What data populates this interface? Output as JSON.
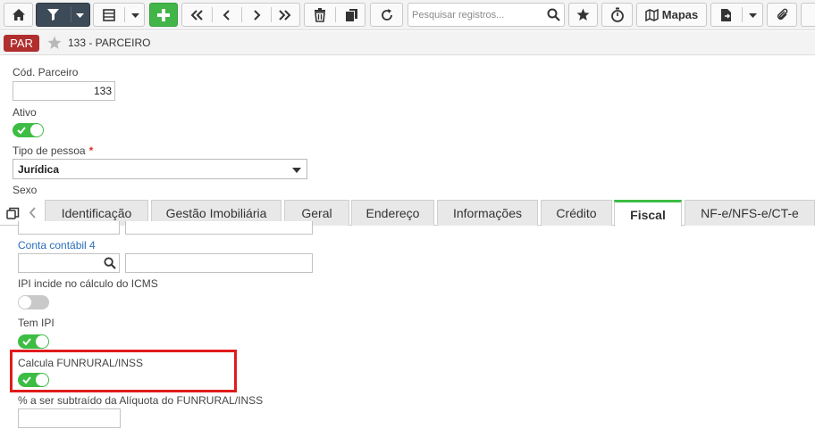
{
  "toolbar": {
    "search_placeholder": "Pesquisar registros...",
    "mapas_label": "Mapas"
  },
  "header": {
    "badge": "PAR",
    "title": "133 - PARCEIRO"
  },
  "form": {
    "cod_parceiro_label": "Cód. Parceiro",
    "cod_parceiro_value": "133",
    "ativo_label": "Ativo",
    "ativo_value": true,
    "tipo_pessoa_label": "Tipo de pessoa",
    "tipo_pessoa_required": "*",
    "tipo_pessoa_value": "Jurídica",
    "sexo_label": "Sexo"
  },
  "tabs": [
    {
      "label": "Identificação"
    },
    {
      "label": "Gestão Imobiliária"
    },
    {
      "label": "Geral"
    },
    {
      "label": "Endereço"
    },
    {
      "label": "Informações"
    },
    {
      "label": "Crédito"
    },
    {
      "label": "Fiscal",
      "active": true
    },
    {
      "label": "NF-e/NFS-e/CT-e"
    }
  ],
  "fiscal": {
    "conta_contabil_label": "Conta contábil 4",
    "ipi_label": "IPI incide no cálculo do ICMS",
    "ipi_value": false,
    "tem_ipi_label": "Tem IPI",
    "tem_ipi_value": true,
    "funrural_label": "Calcula FUNRURAL/INSS",
    "funrural_value": true,
    "percent_label": "% a ser subtraído da Alíquota do FUNRURAL/INSS"
  },
  "colors": {
    "accent_green": "#3dbd44",
    "badge_red": "#b12e2e",
    "highlight_red": "#e01b1b",
    "link_blue": "#2a6ebb"
  }
}
